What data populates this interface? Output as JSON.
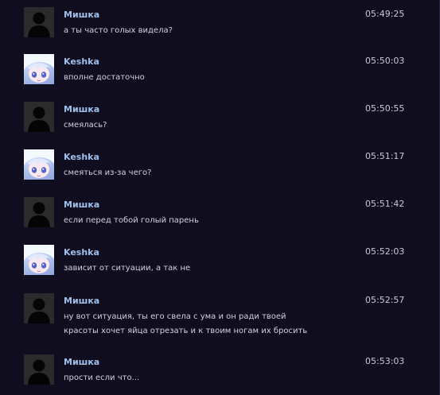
{
  "messages": [
    {
      "author": "Мишка",
      "avatar": "default-avatar-icon",
      "time": "05:49:25",
      "lines": [
        "а ты часто голых видела?"
      ]
    },
    {
      "author": "Keshka",
      "avatar": "anime-avatar-icon",
      "time": "05:50:03",
      "lines": [
        "вполне достаточно"
      ]
    },
    {
      "author": "Мишка",
      "avatar": "default-avatar-icon",
      "time": "05:50:55",
      "lines": [
        "смеялась?"
      ]
    },
    {
      "author": "Keshka",
      "avatar": "anime-avatar-icon",
      "time": "05:51:17",
      "lines": [
        "смеяться из-за чего?"
      ]
    },
    {
      "author": "Мишка",
      "avatar": "default-avatar-icon",
      "time": "05:51:42",
      "lines": [
        "если перед тобой голый парень"
      ]
    },
    {
      "author": "Keshka",
      "avatar": "anime-avatar-icon",
      "time": "05:52:03",
      "lines": [
        "зависит от ситуации, а так не"
      ]
    },
    {
      "author": "Мишка",
      "avatar": "default-avatar-icon",
      "time": "05:52:57",
      "lines": [
        "ну вот ситуация, ты его свела с ума и он ради твоей",
        "красоты хочет яйца отрезать и к твоим ногам их бросить"
      ]
    },
    {
      "author": "Мишка",
      "avatar": "default-avatar-icon",
      "time": "05:53:03",
      "lines": [
        "прости если что..."
      ]
    }
  ],
  "colors": {
    "background": "#0f0d1e",
    "author": "#9fc0eb",
    "message_text": "#d2d2dc",
    "timestamp": "#c9c9d6"
  }
}
